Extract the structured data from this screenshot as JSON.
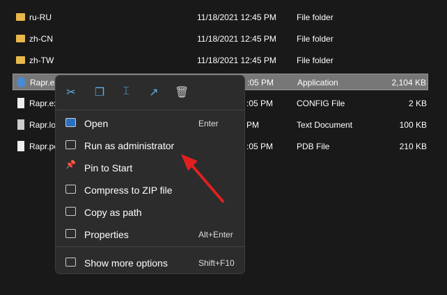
{
  "files": [
    {
      "name": "ru-RU",
      "date": "11/18/2021 12:45 PM",
      "type": "File folder",
      "size": "",
      "icon": "folder-icon"
    },
    {
      "name": "zh-CN",
      "date": "11/18/2021 12:45 PM",
      "type": "File folder",
      "size": "",
      "icon": "folder-icon"
    },
    {
      "name": "zh-TW",
      "date": "11/18/2021 12:45 PM",
      "type": "File folder",
      "size": "",
      "icon": "folder-icon"
    },
    {
      "name": "Rapr.ex",
      "date": ":05 PM",
      "type": "Application",
      "size": "2,104 KB",
      "icon": "application-icon"
    },
    {
      "name": "Rapr.ex",
      "date": ":05 PM",
      "type": "CONFIG File",
      "size": "2 KB",
      "icon": "file-icon"
    },
    {
      "name": "Rapr.lo",
      "date": "PM",
      "type": "Text Document",
      "size": "100 KB",
      "icon": "text-file-icon"
    },
    {
      "name": "Rapr.pc",
      "date": ":05 PM",
      "type": "PDB File",
      "size": "210 KB",
      "icon": "file-icon"
    }
  ],
  "toolbar": [
    "cut-icon",
    "copy-icon",
    "rename-icon",
    "share-icon",
    "delete-icon"
  ],
  "menu": [
    {
      "label": "Open",
      "shortcut": "Enter"
    },
    {
      "label": "Run as administrator",
      "shortcut": ""
    },
    {
      "label": "Pin to Start",
      "shortcut": ""
    },
    {
      "label": "Compress to ZIP file",
      "shortcut": ""
    },
    {
      "label": "Copy as path",
      "shortcut": ""
    },
    {
      "label": "Properties",
      "shortcut": "Alt+Enter"
    },
    {
      "label": "Show more options",
      "shortcut": "Shift+F10"
    }
  ],
  "colors": {
    "accent": "#60b0e8",
    "arrow": "#e02020"
  }
}
